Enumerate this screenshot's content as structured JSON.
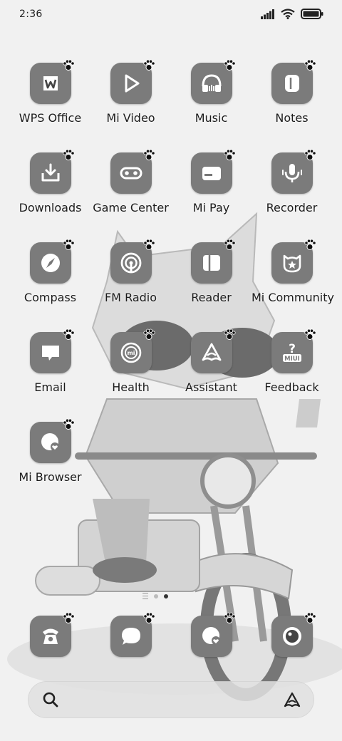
{
  "status_bar": {
    "time": "2:36"
  },
  "apps": [
    {
      "label": "WPS Office",
      "icon": "wps-icon"
    },
    {
      "label": "Mi Video",
      "icon": "play-icon"
    },
    {
      "label": "Music",
      "icon": "headphones-icon"
    },
    {
      "label": "Notes",
      "icon": "notes-icon"
    },
    {
      "label": "Downloads",
      "icon": "download-icon"
    },
    {
      "label": "Game Center",
      "icon": "gamepad-icon"
    },
    {
      "label": "Mi Pay",
      "icon": "wallet-icon"
    },
    {
      "label": "Recorder",
      "icon": "microphone-icon"
    },
    {
      "label": "Compass",
      "icon": "compass-icon"
    },
    {
      "label": "FM Radio",
      "icon": "radio-icon"
    },
    {
      "label": "Reader",
      "icon": "book-icon"
    },
    {
      "label": "Mi Community",
      "icon": "community-icon"
    },
    {
      "label": "Email",
      "icon": "chat-bubble-icon"
    },
    {
      "label": "Health",
      "icon": "health-icon"
    },
    {
      "label": "Assistant",
      "icon": "assistant-icon"
    },
    {
      "label": "Feedback",
      "icon": "feedback-icon"
    },
    {
      "label": "Mi Browser",
      "icon": "browser-icon"
    }
  ],
  "dock": [
    {
      "icon": "phone-icon"
    },
    {
      "icon": "message-icon"
    },
    {
      "icon": "browser-icon"
    },
    {
      "icon": "camera-icon"
    }
  ],
  "page_indicator": {
    "pages": 2,
    "current": 2
  },
  "search_bar": {
    "left_icon": "search-icon",
    "right_icon": "assistant-icon"
  },
  "colors": {
    "tile": "#7b7b7b",
    "glyph": "#ffffff",
    "background": "#f1f1f1"
  },
  "text": {
    "feedback_badge": "MIUI",
    "health_badge": "mi"
  }
}
